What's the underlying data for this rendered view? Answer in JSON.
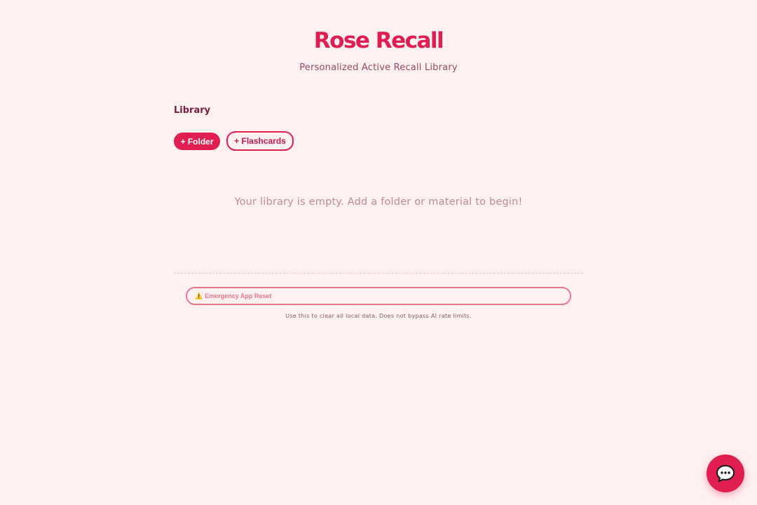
{
  "header": {
    "title": "Rose Recall",
    "subtitle": "Personalized Active Recall Library"
  },
  "library": {
    "heading": "Library",
    "add_folder_label": "+ Folder",
    "add_flashcards_label": "+ Flashcards",
    "empty_message": "Your library is empty. Add a folder or material to begin!"
  },
  "reset": {
    "label": "Emergency App Reset",
    "note": "Use this to clear all local data. Does not bypass AI rate limits."
  },
  "icons": {
    "warning": "warning-icon",
    "chat": "chat-bubble-icon"
  },
  "colors": {
    "accent": "#e01e4f",
    "background": "#fff0f1",
    "muted_text": "#c48a9c",
    "reset_border": "#e8788f"
  }
}
